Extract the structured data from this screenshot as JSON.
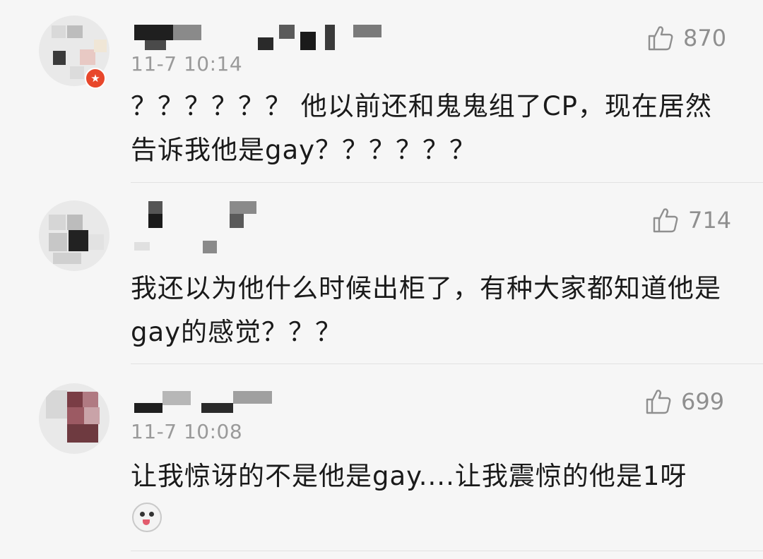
{
  "comments": [
    {
      "time": "11-7 10:14",
      "likes": "870",
      "text": "？？？？？？ 他以前还和鬼鬼组了CP，现在居然告诉我他是gay？？？？？？"
    },
    {
      "time": "",
      "likes": "714",
      "text": "我还以为他什么时候出柜了，有种大家都知道他是gay的感觉？？？"
    },
    {
      "time": "11-7 10:08",
      "likes": "699",
      "text": "让我惊讶的不是他是gay....让我震惊的他是1呀"
    }
  ],
  "icons": {
    "like": "thumbs-up-icon",
    "badge": "star-badge-icon",
    "emoji": "husky-emoji-icon"
  },
  "colors": {
    "background": "#f6f6f6",
    "meta": "#9a9a9a",
    "text": "#1a1a1a",
    "badge": "#e8472b"
  }
}
